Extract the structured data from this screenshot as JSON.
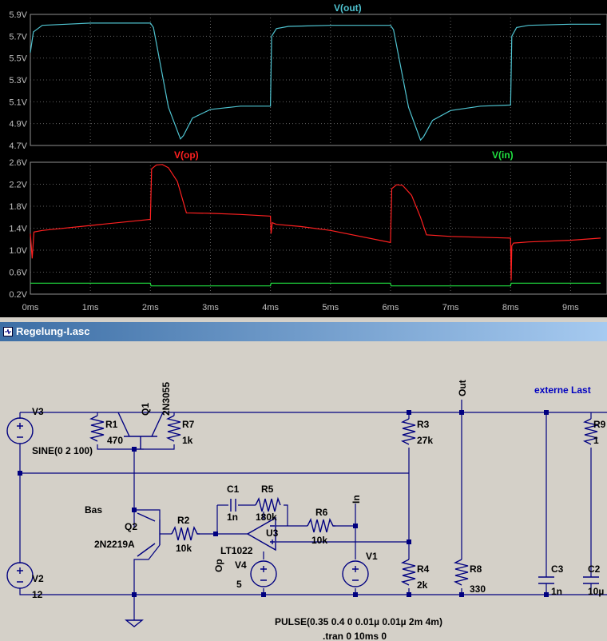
{
  "chart_data": [
    {
      "type": "line",
      "series": [
        {
          "name": "V(out)",
          "color": "#4fc3d0",
          "x": [
            0,
            0.05,
            0.2,
            0.6,
            1.0,
            2.0,
            2.05,
            2.3,
            2.5,
            2.55,
            2.7,
            3.0,
            3.5,
            4.0,
            4.02,
            4.1,
            4.3,
            5.0,
            6.0,
            6.05,
            6.3,
            6.5,
            6.55,
            6.7,
            7.0,
            7.5,
            8.0,
            8.02,
            8.1,
            8.3,
            9.0,
            9.5
          ],
          "values": [
            5.55,
            5.74,
            5.8,
            5.81,
            5.82,
            5.82,
            5.78,
            5.05,
            4.76,
            4.79,
            4.95,
            5.03,
            5.06,
            5.06,
            5.7,
            5.77,
            5.79,
            5.8,
            5.8,
            5.76,
            5.05,
            4.75,
            4.78,
            4.93,
            5.02,
            5.06,
            5.07,
            5.7,
            5.78,
            5.8,
            5.81,
            5.81
          ]
        }
      ],
      "ylim": [
        4.7,
        5.9
      ],
      "xlim": [
        0,
        9.5
      ],
      "yticks": [
        "5.9V",
        "5.7V",
        "5.5V",
        "5.3V",
        "5.1V",
        "4.9V",
        "4.7V"
      ],
      "grid": true
    },
    {
      "type": "line",
      "series": [
        {
          "name": "V(op)",
          "color": "#ff2020",
          "x": [
            0,
            0.03,
            0.06,
            0.2,
            1.0,
            2.0,
            2.02,
            2.1,
            2.2,
            2.3,
            2.45,
            2.6,
            3.0,
            3.5,
            4.0,
            4.01,
            4.03,
            4.1,
            4.5,
            5.0,
            6.0,
            6.02,
            6.1,
            6.2,
            6.35,
            6.5,
            6.6,
            7.0,
            8.0,
            8.01,
            8.02,
            8.05,
            8.3,
            9.0,
            9.5
          ],
          "values": [
            1.3,
            0.85,
            1.33,
            1.36,
            1.45,
            1.56,
            2.48,
            2.55,
            2.56,
            2.5,
            2.25,
            1.68,
            1.67,
            1.65,
            1.62,
            1.3,
            1.5,
            1.47,
            1.43,
            1.36,
            1.14,
            2.12,
            2.19,
            2.18,
            2.0,
            1.6,
            1.28,
            1.25,
            1.22,
            0.45,
            1.08,
            1.13,
            1.15,
            1.18,
            1.22
          ]
        },
        {
          "name": "V(in)",
          "color": "#20e040",
          "x": [
            0,
            2.0,
            2.01,
            4.0,
            4.01,
            6.0,
            6.01,
            8.0,
            8.01,
            9.5
          ],
          "values": [
            0.4,
            0.4,
            0.35,
            0.35,
            0.4,
            0.4,
            0.35,
            0.35,
            0.4,
            0.4
          ]
        }
      ],
      "ylim": [
        0.2,
        2.6
      ],
      "xlim": [
        0,
        9.5
      ],
      "yticks": [
        "2.6V",
        "2.2V",
        "1.8V",
        "1.4V",
        "1.0V",
        "0.6V",
        "0.2V"
      ],
      "xticks": [
        "0ms",
        "1ms",
        "2ms",
        "3ms",
        "4ms",
        "5ms",
        "6ms",
        "7ms",
        "8ms",
        "9ms"
      ],
      "grid": true
    }
  ],
  "schematic_window": {
    "title": "Regelung-I.asc"
  },
  "labels": {
    "v3": "V3",
    "sine": "SINE(0 2 100)",
    "r1": "R1",
    "r1v": "470",
    "q1": "Q1",
    "q1m": "2N3055",
    "r7": "R7",
    "r7v": "1k",
    "bas": "Bas",
    "q2": "Q2",
    "q2m": "2N2219A",
    "r2": "R2",
    "r2v": "10k",
    "c1": "C1",
    "c1v": "1n",
    "r5": "R5",
    "r5v": "180k",
    "r6": "R6",
    "r6v": "10k",
    "u3": "U3",
    "u3m": "LT1022",
    "op": "Op",
    "v4": "V4",
    "v4v": "5",
    "in": "In",
    "v1": "V1",
    "r3": "R3",
    "r3v": "27k",
    "r4": "R4",
    "r4v": "2k",
    "out": "Out",
    "r8": "R8",
    "r8v": "330",
    "ext": "externe Last",
    "c3": "C3",
    "c3v": "1n",
    "r9": "R9",
    "r9v": "1",
    "c2": "C2",
    "c2v": "10µ",
    "v2": "V2",
    "v2v": "12",
    "pulse": "PULSE(0.35 0.4 0 0.01µ 0.01µ 2m 4m)",
    "tran": ".tran 0 10ms 0"
  }
}
